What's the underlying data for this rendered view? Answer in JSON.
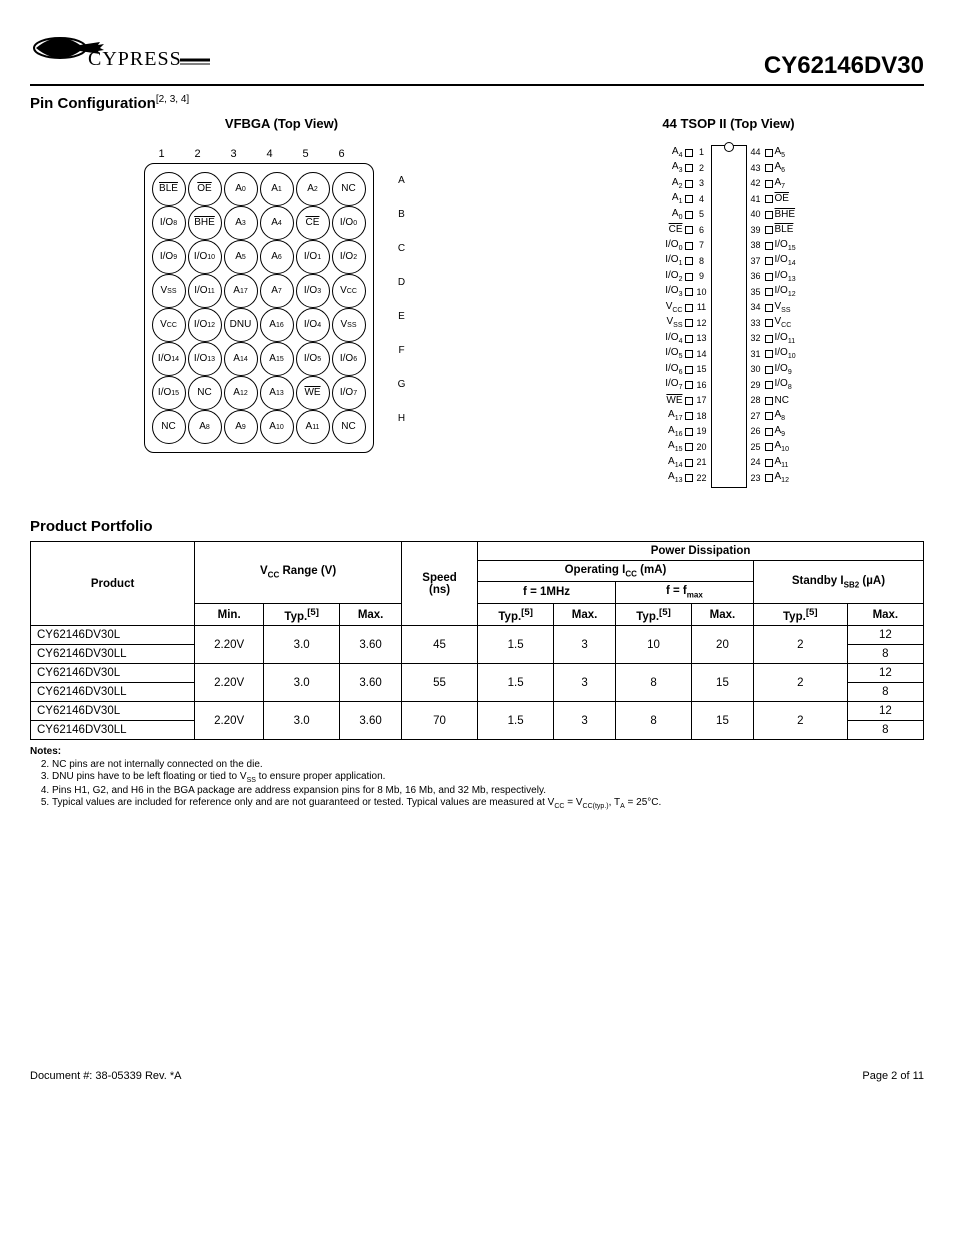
{
  "header": {
    "part_number": "CY62146DV30",
    "logo_text": "CYPRESS"
  },
  "section1": {
    "title": "Pin Configuration",
    "refs": "[2, 3, 4]",
    "bga_caption": "VFBGA (Top View)",
    "tsop_caption": "44 TSOP II (Top View)"
  },
  "bga": {
    "cols": [
      "1",
      "2",
      "3",
      "4",
      "5",
      "6"
    ],
    "rows": [
      "A",
      "B",
      "C",
      "D",
      "E",
      "F",
      "G",
      "H"
    ],
    "cells": [
      [
        {
          "t": "BLE",
          "ov": true
        },
        {
          "t": "OE",
          "ov": true
        },
        {
          "t": "A",
          "s": "0"
        },
        {
          "t": "A",
          "s": "1"
        },
        {
          "t": "A",
          "s": "2"
        },
        {
          "t": "NC"
        }
      ],
      [
        {
          "t": "I/O",
          "s": "8"
        },
        {
          "t": "BHE",
          "ov": true
        },
        {
          "t": "A",
          "s": "3"
        },
        {
          "t": "A",
          "s": "4"
        },
        {
          "t": "CE",
          "ov": true
        },
        {
          "t": "I/O",
          "s": "0"
        }
      ],
      [
        {
          "t": "I/O",
          "s": "9"
        },
        {
          "t": "I/O",
          "s": "10"
        },
        {
          "t": "A",
          "s": "5"
        },
        {
          "t": "A",
          "s": "6"
        },
        {
          "t": "I/O",
          "s": "1"
        },
        {
          "t": "I/O",
          "s": "2"
        }
      ],
      [
        {
          "t": "V",
          "s": "SS"
        },
        {
          "t": "I/O",
          "s": "11"
        },
        {
          "t": "A",
          "s": "17"
        },
        {
          "t": "A",
          "s": "7"
        },
        {
          "t": "I/O",
          "s": "3"
        },
        {
          "t": "V",
          "s": "CC"
        }
      ],
      [
        {
          "t": "V",
          "s": "CC"
        },
        {
          "t": "I/O",
          "s": "12"
        },
        {
          "t": "DNU"
        },
        {
          "t": "A",
          "s": "16"
        },
        {
          "t": "I/O",
          "s": "4"
        },
        {
          "t": "V",
          "s": "SS"
        }
      ],
      [
        {
          "t": "I/O",
          "s": "14"
        },
        {
          "t": "I/O",
          "s": "13"
        },
        {
          "t": "A",
          "s": "14"
        },
        {
          "t": "A",
          "s": "15"
        },
        {
          "t": "I/O",
          "s": "5"
        },
        {
          "t": "I/O",
          "s": "6"
        }
      ],
      [
        {
          "t": "I/O",
          "s": "15"
        },
        {
          "t": "NC"
        },
        {
          "t": "A",
          "s": "12"
        },
        {
          "t": "A",
          "s": "13"
        },
        {
          "t": "WE",
          "ov": true
        },
        {
          "t": "I/O",
          "s": "7"
        }
      ],
      [
        {
          "t": "NC"
        },
        {
          "t": "A",
          "s": "8"
        },
        {
          "t": "A",
          "s": "9"
        },
        {
          "t": "A",
          "s": "10"
        },
        {
          "t": "A",
          "s": "11"
        },
        {
          "t": "NC"
        }
      ]
    ]
  },
  "tsop": {
    "left": [
      {
        "n": 1,
        "t": "A",
        "s": "4"
      },
      {
        "n": 2,
        "t": "A",
        "s": "3"
      },
      {
        "n": 3,
        "t": "A",
        "s": "2"
      },
      {
        "n": 4,
        "t": "A",
        "s": "1"
      },
      {
        "n": 5,
        "t": "A",
        "s": "0"
      },
      {
        "n": 6,
        "t": "CE",
        "ov": true
      },
      {
        "n": 7,
        "t": "I/O",
        "s": "0"
      },
      {
        "n": 8,
        "t": "I/O",
        "s": "1"
      },
      {
        "n": 9,
        "t": "I/O",
        "s": "2"
      },
      {
        "n": 10,
        "t": "I/O",
        "s": "3"
      },
      {
        "n": 11,
        "t": "V",
        "s": "CC"
      },
      {
        "n": 12,
        "t": "V",
        "s": "SS"
      },
      {
        "n": 13,
        "t": "I/O",
        "s": "4"
      },
      {
        "n": 14,
        "t": "I/O",
        "s": "5"
      },
      {
        "n": 15,
        "t": "I/O",
        "s": "6"
      },
      {
        "n": 16,
        "t": "I/O",
        "s": "7"
      },
      {
        "n": 17,
        "t": "WE",
        "ov": true
      },
      {
        "n": 18,
        "t": "A",
        "s": "17"
      },
      {
        "n": 19,
        "t": "A",
        "s": "16"
      },
      {
        "n": 20,
        "t": "A",
        "s": "15"
      },
      {
        "n": 21,
        "t": "A",
        "s": "14"
      },
      {
        "n": 22,
        "t": "A",
        "s": "13"
      }
    ],
    "right": [
      {
        "n": 44,
        "t": "A",
        "s": "5"
      },
      {
        "n": 43,
        "t": "A",
        "s": "6"
      },
      {
        "n": 42,
        "t": "A",
        "s": "7"
      },
      {
        "n": 41,
        "t": "OE",
        "ov": true
      },
      {
        "n": 40,
        "t": "BHE",
        "ov": true
      },
      {
        "n": 39,
        "t": "BLE",
        "ov": true
      },
      {
        "n": 38,
        "t": "I/O",
        "s": "15"
      },
      {
        "n": 37,
        "t": "I/O",
        "s": "14"
      },
      {
        "n": 36,
        "t": "I/O",
        "s": "13"
      },
      {
        "n": 35,
        "t": "I/O",
        "s": "12"
      },
      {
        "n": 34,
        "t": "V",
        "s": "SS"
      },
      {
        "n": 33,
        "t": "V",
        "s": "CC"
      },
      {
        "n": 32,
        "t": "I/O",
        "s": "11"
      },
      {
        "n": 31,
        "t": "I/O",
        "s": "10"
      },
      {
        "n": 30,
        "t": "I/O",
        "s": "9"
      },
      {
        "n": 29,
        "t": "I/O",
        "s": "8"
      },
      {
        "n": 28,
        "t": "NC"
      },
      {
        "n": 27,
        "t": "A",
        "s": "8"
      },
      {
        "n": 26,
        "t": "A",
        "s": "9"
      },
      {
        "n": 25,
        "t": "A",
        "s": "10"
      },
      {
        "n": 24,
        "t": "A",
        "s": "11"
      },
      {
        "n": 23,
        "t": "A",
        "s": "12"
      }
    ]
  },
  "section2": {
    "title": "Product Portfolio"
  },
  "table": {
    "h_product": "Product",
    "h_vcc_range": "V_CC Range (V)",
    "h_min": "Min.",
    "h_typ": "Typ.",
    "h_typ_ref": "[5]",
    "h_max": "Max.",
    "h_speed": "Speed (ns)",
    "h_power": "Power Dissipation",
    "h_icc": "Operating I_CC (mA)",
    "h_f1": "f = 1MHz",
    "h_fmax": "f = f_max",
    "h_standby": "Standby I_SB2 (µA)",
    "rows": [
      {
        "product": "CY62146DV30L",
        "min": "2.20V",
        "typ": "3.0",
        "max": "3.60",
        "speed": "45",
        "f1typ": "1.5",
        "f1max": "3",
        "fmtyp": "10",
        "fmmax": "20",
        "sbtyp": "2",
        "sbmax": "12"
      },
      {
        "product": "CY62146DV30LL",
        "min": "",
        "typ": "",
        "max": "",
        "speed": "",
        "f1typ": "",
        "f1max": "",
        "fmtyp": "",
        "fmmax": "",
        "sbtyp": "",
        "sbmax": "8"
      },
      {
        "product": "CY62146DV30L",
        "min": "2.20V",
        "typ": "3.0",
        "max": "3.60",
        "speed": "55",
        "f1typ": "1.5",
        "f1max": "3",
        "fmtyp": "8",
        "fmmax": "15",
        "sbtyp": "2",
        "sbmax": "12"
      },
      {
        "product": "CY62146DV30LL",
        "min": "",
        "typ": "",
        "max": "",
        "speed": "",
        "f1typ": "",
        "f1max": "",
        "fmtyp": "",
        "fmmax": "",
        "sbtyp": "",
        "sbmax": "8"
      },
      {
        "product": "CY62146DV30L",
        "min": "2.20V",
        "typ": "3.0",
        "max": "3.60",
        "speed": "70",
        "f1typ": "1.5",
        "f1max": "3",
        "fmtyp": "8",
        "fmmax": "15",
        "sbtyp": "2",
        "sbmax": "12"
      },
      {
        "product": "CY62146DV30LL",
        "min": "",
        "typ": "",
        "max": "",
        "speed": "",
        "f1typ": "",
        "f1max": "",
        "fmtyp": "",
        "fmmax": "",
        "sbtyp": "",
        "sbmax": "8"
      }
    ]
  },
  "notes": {
    "title": "Notes:",
    "items": [
      "NC pins are not internally connected on the die.",
      "DNU pins have to be left floating or tied to V_SS to ensure proper application.",
      "Pins H1, G2, and H6 in the BGA package are address expansion pins for 8 Mb, 16 Mb, and 32 Mb, respectively.",
      "Typical values are included for reference only and are not guaranteed or tested. Typical values are measured at V_CC = V_CC(typ.), T_A = 25°C."
    ]
  },
  "footer": {
    "doc": "Document #: 38-05339 Rev. *A",
    "page": "Page 2 of 11"
  }
}
